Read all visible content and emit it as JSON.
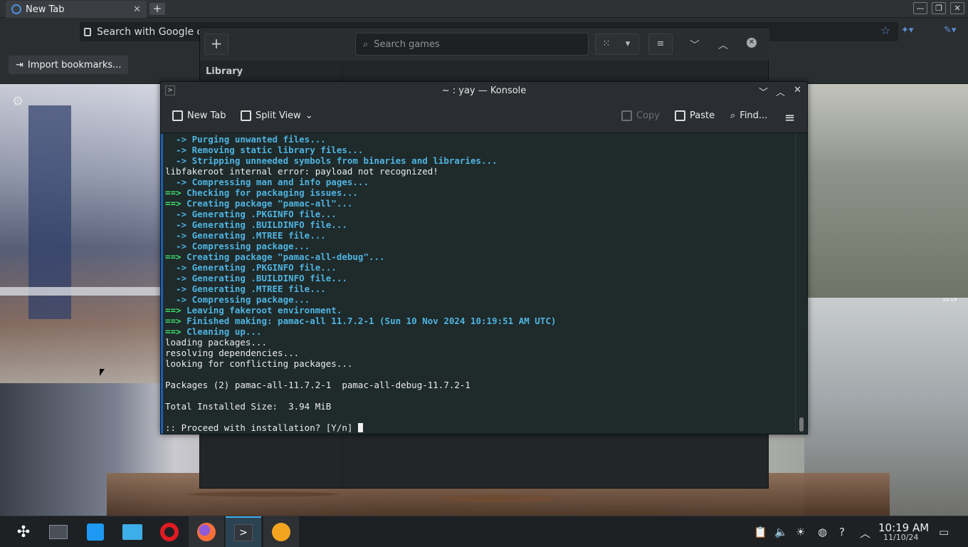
{
  "browser": {
    "tab_title": "New Tab",
    "new_tab_glyph": "+",
    "url_placeholder": "Search with Google c",
    "import_bookmarks": "Import bookmarks...",
    "icons": [
      "firefox-icon",
      "close-icon",
      "star-icon",
      "extension-icon",
      "tools-icon",
      "settings-gear-icon"
    ]
  },
  "launcher": {
    "search_placeholder": "Search games",
    "library_label": "Library",
    "add_glyph": "+"
  },
  "konsole": {
    "title": "~ : yay — Konsole",
    "toolbar": {
      "new_tab": "New Tab",
      "split_view": "Split View",
      "copy": "Copy",
      "paste": "Paste",
      "find": "Find..."
    },
    "lines": [
      {
        "c": "b",
        "t": "  -> Purging unwanted files..."
      },
      {
        "c": "b",
        "t": "  -> Removing static library files..."
      },
      {
        "c": "b",
        "t": "  -> Stripping unneeded symbols from binaries and libraries..."
      },
      {
        "c": "w",
        "t": "libfakeroot internal error: payload not recognized!"
      },
      {
        "c": "b",
        "t": "  -> Compressing man and info pages..."
      },
      {
        "c": "gb",
        "p": "==>",
        "t": " Checking for packaging issues..."
      },
      {
        "c": "gb",
        "p": "==>",
        "t": " Creating package \"pamac-all\"..."
      },
      {
        "c": "b",
        "t": "  -> Generating .PKGINFO file..."
      },
      {
        "c": "b",
        "t": "  -> Generating .BUILDINFO file..."
      },
      {
        "c": "b",
        "t": "  -> Generating .MTREE file..."
      },
      {
        "c": "b",
        "t": "  -> Compressing package..."
      },
      {
        "c": "gb",
        "p": "==>",
        "t": " Creating package \"pamac-all-debug\"..."
      },
      {
        "c": "b",
        "t": "  -> Generating .PKGINFO file..."
      },
      {
        "c": "b",
        "t": "  -> Generating .BUILDINFO file..."
      },
      {
        "c": "b",
        "t": "  -> Generating .MTREE file..."
      },
      {
        "c": "b",
        "t": "  -> Compressing package..."
      },
      {
        "c": "gb",
        "p": "==>",
        "t": " Leaving fakeroot environment."
      },
      {
        "c": "gb",
        "p": "==>",
        "t": " Finished making: pamac-all 11.7.2-1 (Sun 10 Nov 2024 10:19:51 AM UTC)"
      },
      {
        "c": "gb",
        "p": "==>",
        "t": " Cleaning up..."
      },
      {
        "c": "w",
        "t": "loading packages..."
      },
      {
        "c": "w",
        "t": "resolving dependencies..."
      },
      {
        "c": "w",
        "t": "looking for conflicting packages..."
      },
      {
        "c": "w",
        "t": ""
      },
      {
        "c": "w",
        "t": "Packages (2) pamac-all-11.7.2-1  pamac-all-debug-11.7.2-1"
      },
      {
        "c": "w",
        "t": ""
      },
      {
        "c": "w",
        "t": "Total Installed Size:  3.94 MiB"
      },
      {
        "c": "w",
        "t": ""
      },
      {
        "c": "w",
        "t": ":: Proceed with installation? [Y/n] "
      }
    ]
  },
  "wallpaper": {
    "clock": "10:19"
  },
  "taskbar": {
    "apps": [
      "application-launcher-icon",
      "system-settings-icon",
      "discover-store-icon",
      "file-manager-icon",
      "opera-icon",
      "firefox-icon",
      "konsole-icon",
      "game-launcher-icon"
    ],
    "tray": [
      "clipboard-icon",
      "volume-icon",
      "brightness-icon",
      "network-icon",
      "help-icon",
      "expand-tray-icon"
    ],
    "time": "10:19 AM",
    "date": "11/10/24"
  },
  "colors": {
    "accent": "#3daee9",
    "term_blue": "#4fb4e0",
    "term_green": "#3fe06b",
    "term_bg": "#1f2a2b"
  }
}
